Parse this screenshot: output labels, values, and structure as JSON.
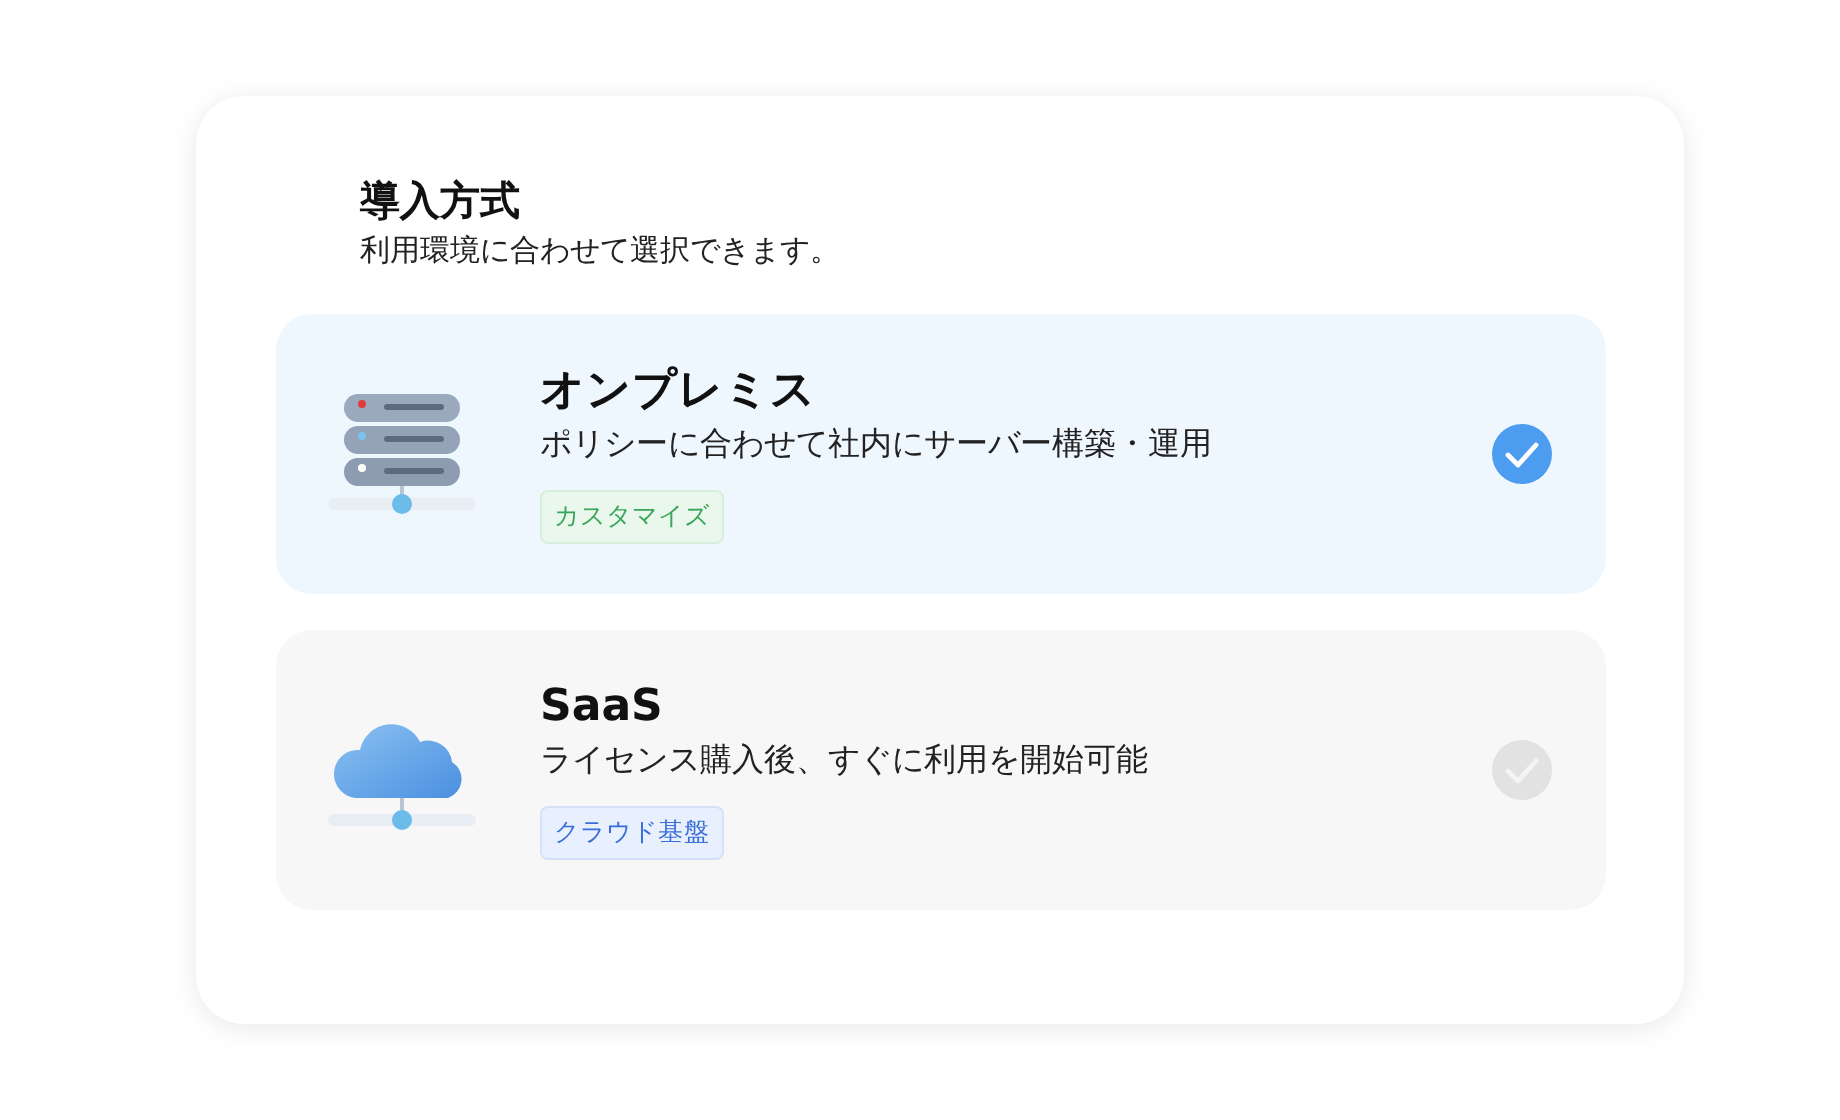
{
  "title": "導入方式",
  "subtitle": "利用環境に合わせて選択できます。",
  "options": [
    {
      "kind": "server",
      "name": "オンプレミス",
      "description": "ポリシーに合わせて社内にサーバー構築・運用",
      "tag": "カスタマイズ",
      "selected": true
    },
    {
      "kind": "cloud",
      "name": "SaaS",
      "description": "ライセンス購入後、すぐに利用を開始可能",
      "tag": "クラウド基盤",
      "selected": false
    }
  ]
}
